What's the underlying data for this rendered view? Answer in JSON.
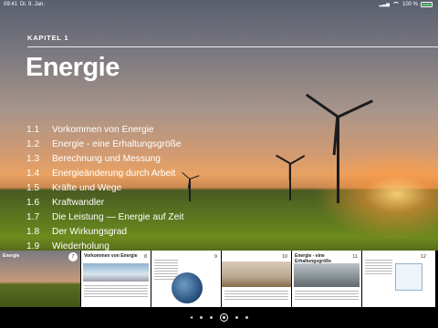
{
  "status_bar": {
    "time": "09:41",
    "date": "Di. 9. Jan.",
    "battery": "100 %",
    "icons": [
      "signal-icon",
      "wifi-icon",
      "battery-icon"
    ]
  },
  "chapter": {
    "label": "KAPITEL 1",
    "title": "Energie"
  },
  "toc": [
    {
      "num": "1.1",
      "title": "Vorkommen von Energie"
    },
    {
      "num": "1.2",
      "title": "Energie - eine Erhaltungsgröße"
    },
    {
      "num": "1.3",
      "title": "Berechnung und Messung"
    },
    {
      "num": "1.4",
      "title": "Energieänderung durch Arbeit"
    },
    {
      "num": "1.5",
      "title": "Kräfte und Wege"
    },
    {
      "num": "1.6",
      "title": "Kraftwandler"
    },
    {
      "num": "1.7",
      "title": "Die Leistung — Energie auf Zeit"
    },
    {
      "num": "1.8",
      "title": "Der Wirkungsgrad"
    },
    {
      "num": "1.9",
      "title": "Wiederholung"
    }
  ],
  "thumbnails": [
    {
      "title": "Energie",
      "page": "7"
    },
    {
      "title": "Vorkommen von Energie",
      "page": "8"
    },
    {
      "title": "",
      "page": "9"
    },
    {
      "title": "",
      "page": "10"
    },
    {
      "title": "Energie - eine Erhaltungsgröße",
      "page": "11"
    },
    {
      "title": "",
      "page": "12"
    }
  ],
  "pager": {
    "prev_arrow": "◂",
    "next_arrow": "▸",
    "dot_count": 5,
    "current_index": 2
  },
  "colors": {
    "accent_battery": "#4cd964",
    "title_text": "#ffffff"
  }
}
